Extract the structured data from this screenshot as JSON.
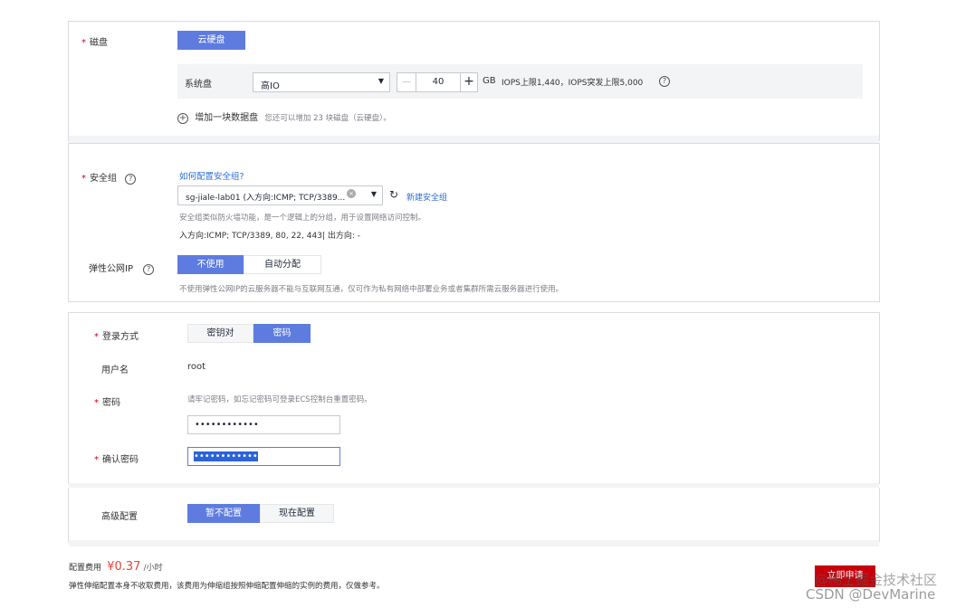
{
  "disk": {
    "label": "磁盘",
    "type_button": "云硬盘",
    "system_disk_label": "系统盘",
    "disk_type": "高IO",
    "size": "40",
    "unit": "GB",
    "iops_text": "IOPS上限1,440，IOPS突发上限5,000",
    "add_data_disk": "增加一块数据盘",
    "add_hint": "您还可以增加 23 块磁盘（云硬盘）。"
  },
  "security": {
    "label": "安全组",
    "help_link": "如何配置安全组?",
    "selected": "sg-jiale-lab01 (入方向:ICMP; TCP/3389...",
    "new_group": "新建安全组",
    "desc": "安全组类似防火墙功能，是一个逻辑上的分组，用于设置网络访问控制。",
    "rules": "入方向:ICMP; TCP/3389, 80, 22, 443| 出方向: -"
  },
  "eip": {
    "label": "弹性公网IP",
    "option_none": "不使用",
    "option_auto": "自动分配",
    "desc": "不使用弹性公网IP的云服务器不能与互联网互通，仅可作为私有网络中部署业务或者集群所需云服务器进行使用。"
  },
  "login": {
    "label": "登录方式",
    "option_keypair": "密钥对",
    "option_password": "密码",
    "username_label": "用户名",
    "username": "root",
    "password_label": "密码",
    "password_hint": "请牢记密码，如忘记密码可登录ECS控制台重置密码。",
    "password_value": "••••••••••••",
    "confirm_label": "确认密码",
    "confirm_value": "••••••••••••"
  },
  "advanced": {
    "label": "高级配置",
    "option_no": "暂不配置",
    "option_now": "现在配置"
  },
  "footer": {
    "fee_label": "配置费用",
    "price": "¥0.37",
    "per": "/小时",
    "note": "弹性伸缩配置本身不收取费用，该费用为伸缩组按照伸缩配置伸缩的实例的费用，仅做参考。",
    "buy_button": "立即申请"
  },
  "watermark": {
    "line1": "@稀土掘金技术社区",
    "line2": "CSDN @DevMarine"
  },
  "colors": {
    "primary": "#5e7ce0",
    "required": "#d0021b",
    "price": "#e0453c",
    "buy": "#c7000b",
    "link": "#2f6cd8"
  }
}
